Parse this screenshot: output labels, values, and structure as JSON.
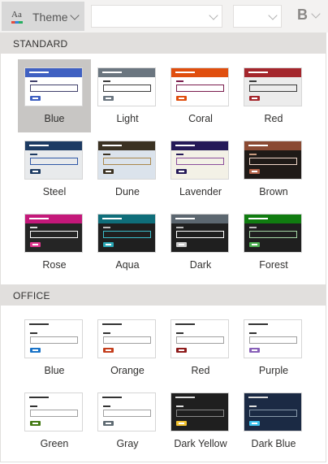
{
  "toolbar": {
    "theme_icon_text": "Aa",
    "theme_label": "Theme",
    "bold_label": "B"
  },
  "sections": [
    {
      "title": "STANDARD",
      "themes": [
        {
          "name": "Blue",
          "bg": "#ffffff",
          "header": "#3f60c2",
          "headerLine": "#ffffff",
          "accent": "#3f60c2",
          "inputBorder": "#3f3f6b",
          "lineOnBg": "#3f3f6b",
          "selected": true
        },
        {
          "name": "Light",
          "bg": "#ffffff",
          "header": "#6b7680",
          "headerLine": "#ffffff",
          "accent": "#6b7680",
          "inputBorder": "#3b3b3b",
          "lineOnBg": "#3b3b3b"
        },
        {
          "name": "Coral",
          "bg": "#ffffff",
          "header": "#e04e0e",
          "headerLine": "#ffffff",
          "accent": "#e04e0e",
          "inputBorder": "#7a1d4d",
          "lineOnBg": "#7a1d4d"
        },
        {
          "name": "Red",
          "bg": "#ececec",
          "header": "#a4262c",
          "headerLine": "#ffffff",
          "accent": "#a4262c",
          "inputBorder": "#3b3b3b",
          "lineOnBg": "#3b3b3b"
        },
        {
          "name": "Steel",
          "bg": "#e8eaec",
          "header": "#1d3b63",
          "headerLine": "#ffffff",
          "accent": "#1d3b63",
          "inputBorder": "#2f57a6",
          "lineOnBg": "#1d3b63"
        },
        {
          "name": "Dune",
          "bg": "#dbe3ec",
          "header": "#3b3222",
          "headerLine": "#ffffff",
          "accent": "#3b3222",
          "inputBorder": "#a9874b",
          "lineOnBg": "#3b3222"
        },
        {
          "name": "Lavender",
          "bg": "#f3f1e6",
          "header": "#251a58",
          "headerLine": "#ffffff",
          "accent": "#251a58",
          "inputBorder": "#8b4d9b",
          "lineOnBg": "#251a58"
        },
        {
          "name": "Brown",
          "bg": "#1f1a17",
          "header": "#8a4a33",
          "headerLine": "#ffffff",
          "accent": "#b4644a",
          "inputBorder": "#f0d6c8",
          "lineOnBg": "#c89b7e"
        },
        {
          "name": "Rose",
          "bg": "#252525",
          "header": "#c4187a",
          "headerLine": "#ffffff",
          "accent": "#e0368e",
          "inputBorder": "#ffffff",
          "lineOnBg": "#dddddd"
        },
        {
          "name": "Aqua",
          "bg": "#1f1f1f",
          "header": "#0f6e7a",
          "headerLine": "#ffffff",
          "accent": "#2aa7b5",
          "inputBorder": "#3bbcc9",
          "lineOnBg": "#bbbbbb"
        },
        {
          "name": "Dark",
          "bg": "#1f1f1f",
          "header": "#5c6770",
          "headerLine": "#ffffff",
          "accent": "#cccccc",
          "inputBorder": "#ffffff",
          "lineOnBg": "#bbbbbb"
        },
        {
          "name": "Forest",
          "bg": "#1f1f1f",
          "header": "#107c10",
          "headerLine": "#ffffff",
          "accent": "#4caf50",
          "inputBorder": "#a6d8a6",
          "lineOnBg": "#bbbbbb"
        }
      ]
    },
    {
      "title": "OFFICE",
      "themes": [
        {
          "name": "Blue",
          "bg": "#ffffff",
          "header": "#ffffff",
          "headerLine": "#333333",
          "accent": "#1a73c7",
          "inputBorder": "#a0a0a0",
          "lineOnBg": "#333333"
        },
        {
          "name": "Orange",
          "bg": "#ffffff",
          "header": "#ffffff",
          "headerLine": "#333333",
          "accent": "#c43e1c",
          "inputBorder": "#a0a0a0",
          "lineOnBg": "#333333"
        },
        {
          "name": "Red",
          "bg": "#ffffff",
          "header": "#ffffff",
          "headerLine": "#333333",
          "accent": "#8e1b1b",
          "inputBorder": "#a0a0a0",
          "lineOnBg": "#333333"
        },
        {
          "name": "Purple",
          "bg": "#ffffff",
          "header": "#ffffff",
          "headerLine": "#333333",
          "accent": "#8860b8",
          "inputBorder": "#a0a0a0",
          "lineOnBg": "#333333"
        },
        {
          "name": "Green",
          "bg": "#ffffff",
          "header": "#ffffff",
          "headerLine": "#333333",
          "accent": "#437a13",
          "inputBorder": "#a0a0a0",
          "lineOnBg": "#333333"
        },
        {
          "name": "Gray",
          "bg": "#ffffff",
          "header": "#ffffff",
          "headerLine": "#333333",
          "accent": "#5f6b73",
          "inputBorder": "#a0a0a0",
          "lineOnBg": "#333333"
        },
        {
          "name": "Dark Yellow",
          "bg": "#1f1f1f",
          "header": "#1f1f1f",
          "headerLine": "#dddddd",
          "accent": "#f2c230",
          "inputBorder": "#888888",
          "lineOnBg": "#dddddd"
        },
        {
          "name": "Dark Blue",
          "bg": "#1b2a44",
          "header": "#1b2a44",
          "headerLine": "#dddddd",
          "accent": "#3cc3ef",
          "inputBorder": "#8899aa",
          "lineOnBg": "#dddddd"
        }
      ]
    }
  ]
}
